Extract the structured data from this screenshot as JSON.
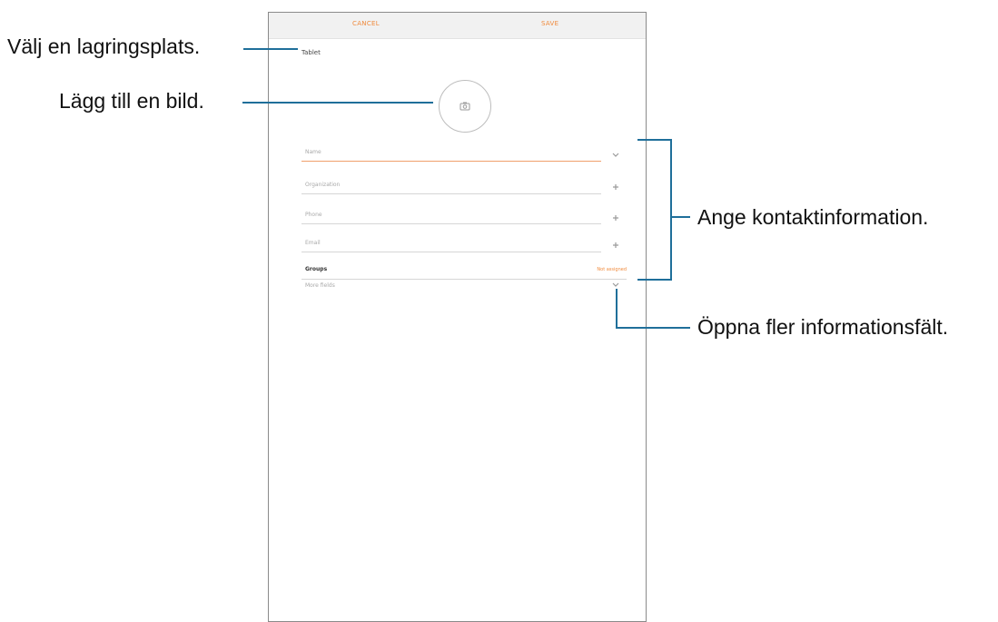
{
  "screen": {
    "topbar": {
      "left_action": "CANCEL",
      "right_action": "SAVE"
    },
    "storage_location": "Tablet",
    "photo_icon": "camera-icon",
    "fields": [
      {
        "placeholder": "Name",
        "expander_icon": "chevron-down-icon"
      },
      {
        "placeholder": "Organization",
        "expander_icon": "plus-icon"
      },
      {
        "placeholder": "Phone",
        "expander_icon": "plus-icon"
      },
      {
        "placeholder": "Email",
        "expander_icon": "plus-icon"
      }
    ],
    "groups": {
      "label": "Groups",
      "link": "Not assigned"
    },
    "more_fields": {
      "placeholder": "More fields",
      "expander_icon": "chevron-down-icon"
    },
    "accent_color": "#f08a3c"
  },
  "callouts": {
    "storage": "Välj en lagringsplats.",
    "picture": "Lägg till en bild.",
    "contact_info": "Ange kontaktinformation.",
    "more_fields": "Öppna fler informationsfält."
  },
  "callout_line_color": "#1f6f9a"
}
